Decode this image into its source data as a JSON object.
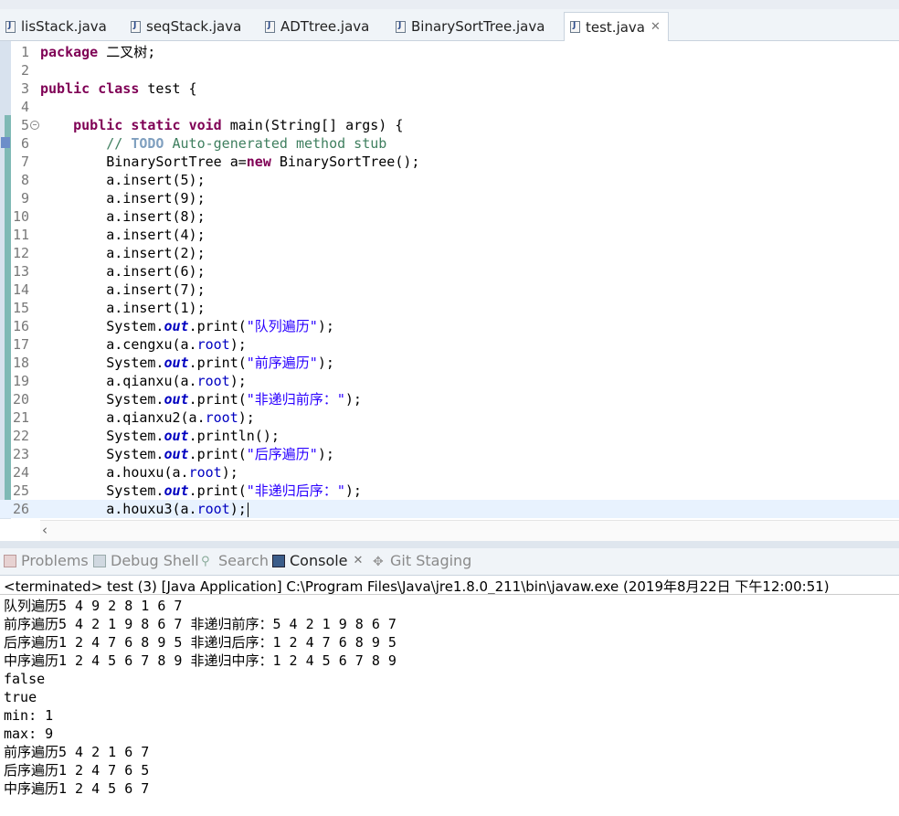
{
  "editor_tabs": [
    {
      "label": "lisStack.java"
    },
    {
      "label": "seqStack.java"
    },
    {
      "label": "ADTtree.java"
    },
    {
      "label": "BinarySortTree.java"
    },
    {
      "label": "test.java",
      "active": true
    }
  ],
  "editor": {
    "line_numbers": [
      "1",
      "2",
      "3",
      "4",
      "5",
      "6",
      "7",
      "8",
      "9",
      "10",
      "11",
      "12",
      "13",
      "14",
      "15",
      "16",
      "17",
      "18",
      "19",
      "20",
      "21",
      "22",
      "23",
      "24",
      "25",
      "26"
    ],
    "lines": [
      [
        [
          "kw",
          "package"
        ],
        [
          "t",
          " 二叉树;"
        ]
      ],
      [],
      [
        [
          "kw",
          "public"
        ],
        [
          "t",
          " "
        ],
        [
          "kw",
          "class"
        ],
        [
          "t",
          " test {"
        ]
      ],
      [],
      [
        [
          "t",
          "    "
        ],
        [
          "kw",
          "public"
        ],
        [
          "t",
          " "
        ],
        [
          "kw",
          "static"
        ],
        [
          "t",
          " "
        ],
        [
          "kw",
          "void"
        ],
        [
          "t",
          " main(String[] args) {"
        ]
      ],
      [
        [
          "t",
          "        "
        ],
        [
          "cm",
          "// "
        ],
        [
          "todo",
          "TODO"
        ],
        [
          "cm",
          " Auto-generated method stub"
        ]
      ],
      [
        [
          "t",
          "        BinarySortTree a="
        ],
        [
          "kw",
          "new"
        ],
        [
          "t",
          " BinarySortTree();"
        ]
      ],
      [
        [
          "t",
          "        a.insert(5);"
        ]
      ],
      [
        [
          "t",
          "        a.insert(9);"
        ]
      ],
      [
        [
          "t",
          "        a.insert(8);"
        ]
      ],
      [
        [
          "t",
          "        a.insert(4);"
        ]
      ],
      [
        [
          "t",
          "        a.insert(2);"
        ]
      ],
      [
        [
          "t",
          "        a.insert(6);"
        ]
      ],
      [
        [
          "t",
          "        a.insert(7);"
        ]
      ],
      [
        [
          "t",
          "        a.insert(1);"
        ]
      ],
      [
        [
          "t",
          "        System."
        ],
        [
          "sfld",
          "out"
        ],
        [
          "t",
          ".print("
        ],
        [
          "str",
          "\"队列遍历\""
        ],
        [
          "t",
          ");"
        ]
      ],
      [
        [
          "t",
          "        a.cengxu(a."
        ],
        [
          "fld",
          "root"
        ],
        [
          "t",
          ");"
        ]
      ],
      [
        [
          "t",
          "        System."
        ],
        [
          "sfld",
          "out"
        ],
        [
          "t",
          ".print("
        ],
        [
          "str",
          "\"前序遍历\""
        ],
        [
          "t",
          ");"
        ]
      ],
      [
        [
          "t",
          "        a.qianxu(a."
        ],
        [
          "fld",
          "root"
        ],
        [
          "t",
          ");"
        ]
      ],
      [
        [
          "t",
          "        System."
        ],
        [
          "sfld",
          "out"
        ],
        [
          "t",
          ".print("
        ],
        [
          "str",
          "\"非递归前序：\""
        ],
        [
          "t",
          ");"
        ]
      ],
      [
        [
          "t",
          "        a.qianxu2(a."
        ],
        [
          "fld",
          "root"
        ],
        [
          "t",
          ");"
        ]
      ],
      [
        [
          "t",
          "        System."
        ],
        [
          "sfld",
          "out"
        ],
        [
          "t",
          ".println();"
        ]
      ],
      [
        [
          "t",
          "        System."
        ],
        [
          "sfld",
          "out"
        ],
        [
          "t",
          ".print("
        ],
        [
          "str",
          "\"后序遍历\""
        ],
        [
          "t",
          ");"
        ]
      ],
      [
        [
          "t",
          "        a.houxu(a."
        ],
        [
          "fld",
          "root"
        ],
        [
          "t",
          ");"
        ]
      ],
      [
        [
          "t",
          "        System."
        ],
        [
          "sfld",
          "out"
        ],
        [
          "t",
          ".print("
        ],
        [
          "str",
          "\"非递归后序：\""
        ],
        [
          "t",
          ");"
        ]
      ],
      [
        [
          "t",
          "        a.houxu3(a."
        ],
        [
          "fld",
          "root"
        ],
        [
          "t",
          ");"
        ]
      ]
    ]
  },
  "view_tabs": [
    {
      "label": "Problems",
      "icon": "problems-icon"
    },
    {
      "label": "Debug Shell",
      "icon": "debug-shell-icon"
    },
    {
      "label": "Search",
      "icon": "search-icon"
    },
    {
      "label": "Console",
      "icon": "console-icon",
      "active": true
    },
    {
      "label": "Git Staging",
      "icon": "git-staging-icon"
    }
  ],
  "console": {
    "status": "<terminated> test (3) [Java Application] C:\\Program Files\\Java\\jre1.8.0_211\\bin\\javaw.exe (2019年8月22日 下午12:00:51)",
    "lines": [
      "队列遍历5 4 9 2 8 1 6 7",
      "前序遍历5 4 2 1 9 8 6 7 非递归前序：5 4 2 1 9 8 6 7",
      "后序遍历1 2 4 7 6 8 9 5 非递归后序：1 2 4 7 6 8 9 5",
      "中序遍历1 2 4 5 6 7 8 9 非递归中序：1 2 4 5 6 7 8 9",
      "false",
      "true",
      "min: 1",
      "max: 9",
      "前序遍历5 4 2 1 6 7",
      "后序遍历1 2 4 7 6 5",
      "中序遍历1 2 4 5 6 7"
    ]
  }
}
